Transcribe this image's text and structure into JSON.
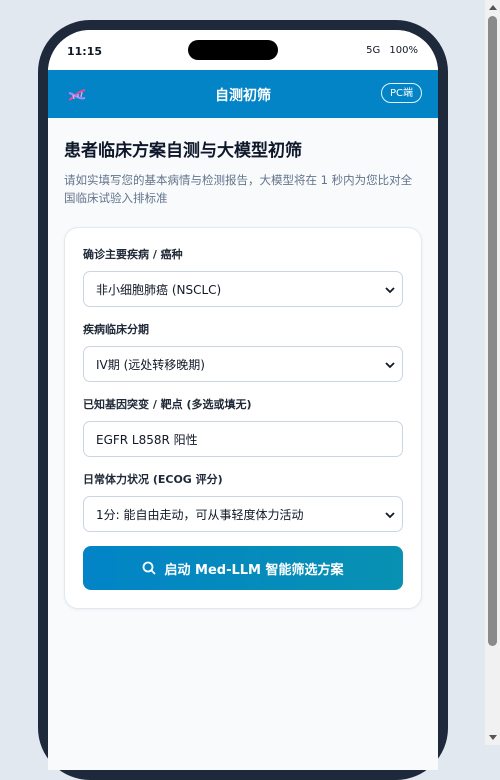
{
  "status": {
    "time": "11:15",
    "network": "5G",
    "battery": "100%"
  },
  "appbar": {
    "title": "自测初筛",
    "pc_label": "PC端",
    "logo_icon": "dna-icon"
  },
  "intro": {
    "title": "患者临床方案自测与大模型初筛",
    "description": "请如实填写您的基本病情与检测报告，大模型将在 1 秒内为您比对全国临床试验入排标准"
  },
  "form": {
    "diagnosis": {
      "label": "确诊主要疾病 / 癌种",
      "value": "非小细胞肺癌 (NSCLC)"
    },
    "stage": {
      "label": "疾病临床分期",
      "value": "IV期 (远处转移晚期)"
    },
    "mutation": {
      "label": "已知基因突变 / 靶点 (多选或填无)",
      "value": "EGFR L858R 阳性"
    },
    "ecog": {
      "label": "日常体力状况 (ECOG 评分)",
      "value": "1分: 能自由走动，可从事轻度体力活动"
    },
    "submit_label": "启动 Med-LLM 智能筛选方案"
  },
  "colors": {
    "primary": "#0284c7",
    "accent": "#0891b2",
    "frame": "#1e293b"
  }
}
